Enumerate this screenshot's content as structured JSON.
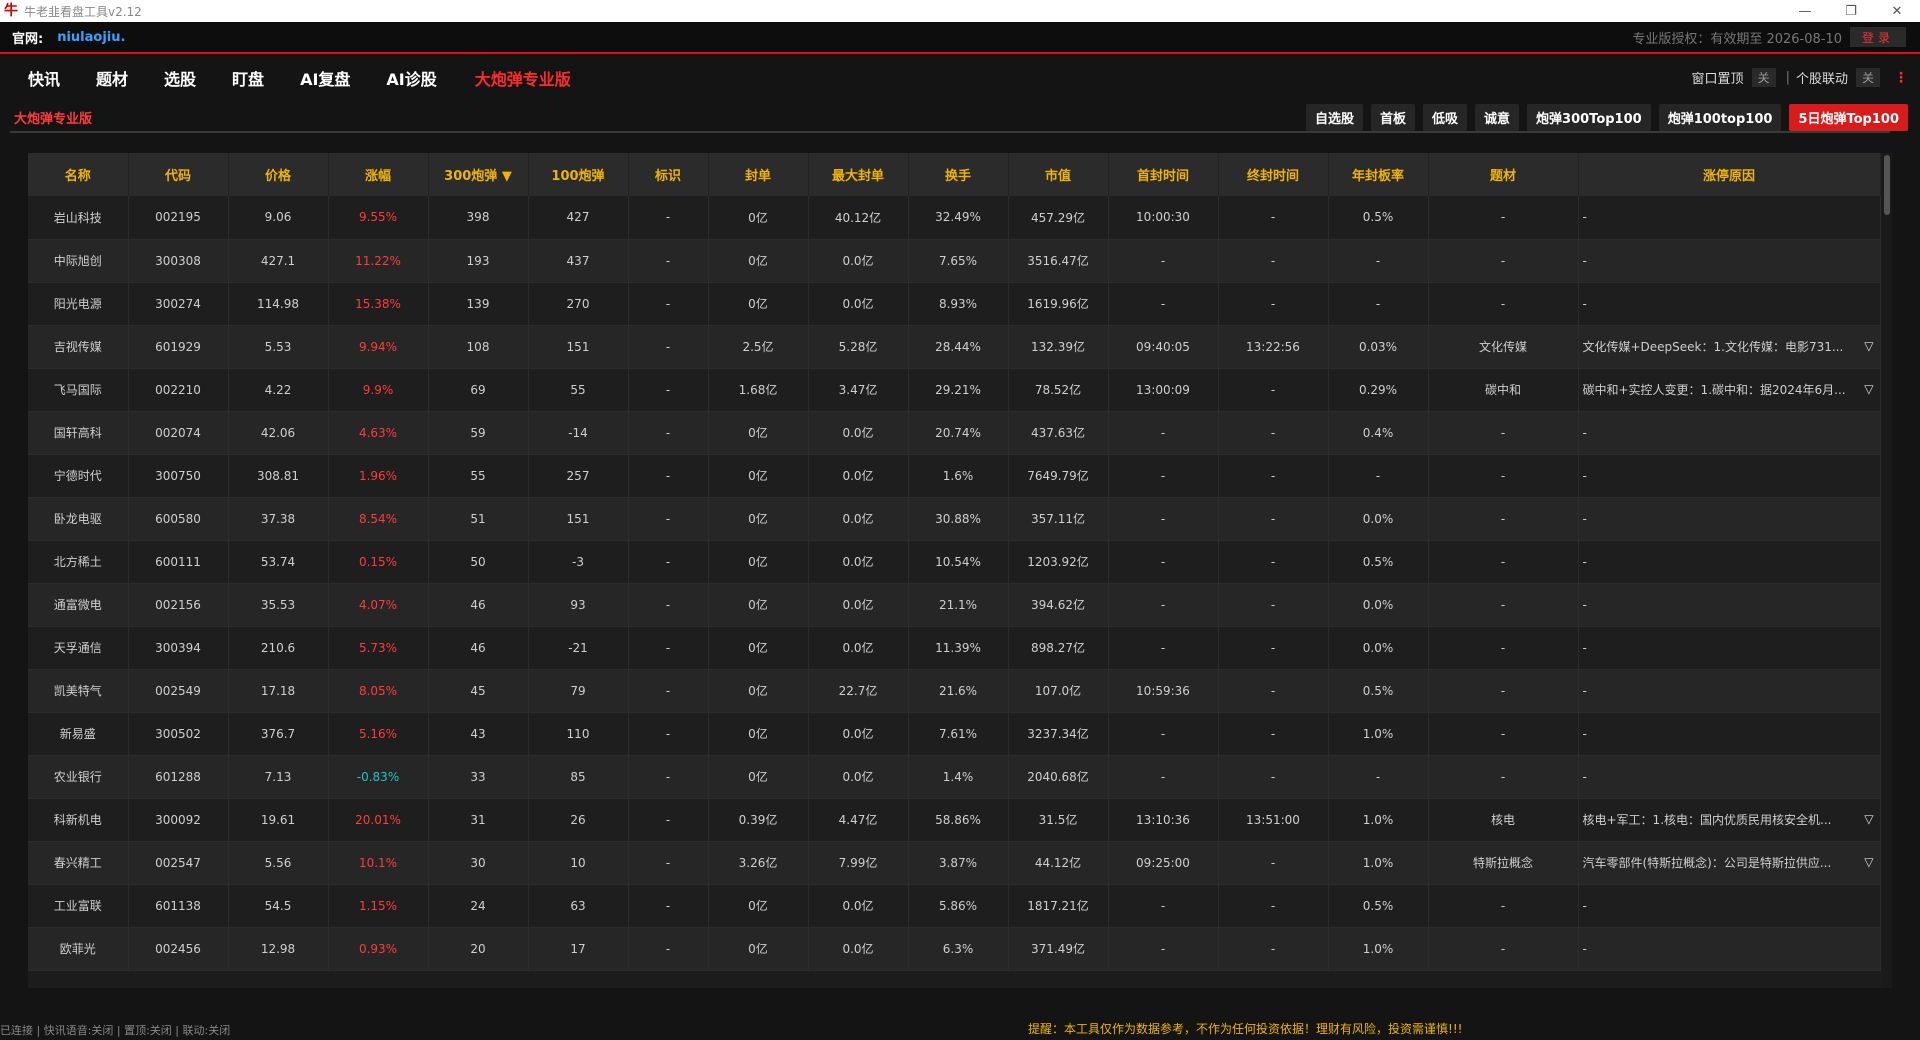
{
  "window": {
    "title": "牛老韭看盘工具v2.12",
    "logo_char": "牛",
    "minimize": "—",
    "maximize": "❐",
    "close": "✕"
  },
  "site": {
    "label": "官网:",
    "url_text": "niulaojiu.",
    "license": "专业版授权：有效期至 2026-08-10",
    "login": "登录"
  },
  "nav": {
    "items": [
      "快讯",
      "题材",
      "选股",
      "盯盘",
      "AI复盘",
      "AI诊股",
      "大炮弹专业版"
    ],
    "window_top_label": "窗口置顶",
    "window_top_state": "关",
    "stock_link_label": "个股联动",
    "stock_link_state": "关",
    "sep": "|",
    "more": "⋮"
  },
  "page": {
    "title": "大炮弹专业版",
    "tabs": [
      "自选股",
      "首板",
      "低吸",
      "诚意",
      "炮弹300Top100",
      "炮弹100top100",
      "5日炮弹Top100"
    ],
    "active_tab": 6
  },
  "table": {
    "columns": [
      "名称",
      "代码",
      "价格",
      "涨幅",
      "300炮弹 ▼",
      "100炮弹",
      "标识",
      "封单",
      "最大封单",
      "换手",
      "市值",
      "首封时间",
      "终封时间",
      "年封板率",
      "题材",
      "涨停原因"
    ],
    "rows": [
      [
        "岩山科技",
        "002195",
        "9.06",
        "9.55%",
        "398",
        "427",
        "-",
        "0亿",
        "40.12亿",
        "32.49%",
        "457.29亿",
        "10:00:30",
        "-",
        "0.5%",
        "-",
        "-"
      ],
      [
        "中际旭创",
        "300308",
        "427.1",
        "11.22%",
        "193",
        "437",
        "-",
        "0亿",
        "0.0亿",
        "7.65%",
        "3516.47亿",
        "-",
        "-",
        "-",
        "-",
        "-"
      ],
      [
        "阳光电源",
        "300274",
        "114.98",
        "15.38%",
        "139",
        "270",
        "-",
        "0亿",
        "0.0亿",
        "8.93%",
        "1619.96亿",
        "-",
        "-",
        "-",
        "-",
        "-"
      ],
      [
        "吉视传媒",
        "601929",
        "5.53",
        "9.94%",
        "108",
        "151",
        "-",
        "2.5亿",
        "5.28亿",
        "28.44%",
        "132.39亿",
        "09:40:05",
        "13:22:56",
        "0.03%",
        "文化传媒",
        "文化传媒+DeepSeek：1.文化传媒：电影731..."
      ],
      [
        "飞马国际",
        "002210",
        "4.22",
        "9.9%",
        "69",
        "55",
        "-",
        "1.68亿",
        "3.47亿",
        "29.21%",
        "78.52亿",
        "13:00:09",
        "-",
        "0.29%",
        "碳中和",
        "碳中和+实控人变更：1.碳中和：据2024年6月..."
      ],
      [
        "国轩高科",
        "002074",
        "42.06",
        "4.63%",
        "59",
        "-14",
        "-",
        "0亿",
        "0.0亿",
        "20.74%",
        "437.63亿",
        "-",
        "-",
        "0.4%",
        "-",
        "-"
      ],
      [
        "宁德时代",
        "300750",
        "308.81",
        "1.96%",
        "55",
        "257",
        "-",
        "0亿",
        "0.0亿",
        "1.6%",
        "7649.79亿",
        "-",
        "-",
        "-",
        "-",
        "-"
      ],
      [
        "卧龙电驱",
        "600580",
        "37.38",
        "8.54%",
        "51",
        "151",
        "-",
        "0亿",
        "0.0亿",
        "30.88%",
        "357.11亿",
        "-",
        "-",
        "0.0%",
        "-",
        "-"
      ],
      [
        "北方稀土",
        "600111",
        "53.74",
        "0.15%",
        "50",
        "-3",
        "-",
        "0亿",
        "0.0亿",
        "10.54%",
        "1203.92亿",
        "-",
        "-",
        "0.5%",
        "-",
        "-"
      ],
      [
        "通富微电",
        "002156",
        "35.53",
        "4.07%",
        "46",
        "93",
        "-",
        "0亿",
        "0.0亿",
        "21.1%",
        "394.62亿",
        "-",
        "-",
        "0.0%",
        "-",
        "-"
      ],
      [
        "天孚通信",
        "300394",
        "210.6",
        "5.73%",
        "46",
        "-21",
        "-",
        "0亿",
        "0.0亿",
        "11.39%",
        "898.27亿",
        "-",
        "-",
        "0.0%",
        "-",
        "-"
      ],
      [
        "凯美特气",
        "002549",
        "17.18",
        "8.05%",
        "45",
        "79",
        "-",
        "0亿",
        "22.7亿",
        "21.6%",
        "107.0亿",
        "10:59:36",
        "-",
        "0.5%",
        "-",
        "-"
      ],
      [
        "新易盛",
        "300502",
        "376.7",
        "5.16%",
        "43",
        "110",
        "-",
        "0亿",
        "0.0亿",
        "7.61%",
        "3237.34亿",
        "-",
        "-",
        "1.0%",
        "-",
        "-"
      ],
      [
        "农业银行",
        "601288",
        "7.13",
        "-0.83%",
        "33",
        "85",
        "-",
        "0亿",
        "0.0亿",
        "1.4%",
        "2040.68亿",
        "-",
        "-",
        "-",
        "-",
        "-"
      ],
      [
        "科新机电",
        "300092",
        "19.61",
        "20.01%",
        "31",
        "26",
        "-",
        "0.39亿",
        "4.47亿",
        "58.86%",
        "31.5亿",
        "13:10:36",
        "13:51:00",
        "1.0%",
        "核电",
        "核电+军工：1.核电：国内优质民用核安全机..."
      ],
      [
        "春兴精工",
        "002547",
        "5.56",
        "10.1%",
        "30",
        "10",
        "-",
        "3.26亿",
        "7.99亿",
        "3.87%",
        "44.12亿",
        "09:25:00",
        "-",
        "1.0%",
        "特斯拉概念",
        "汽车零部件(特斯拉概念)：公司是特斯拉供应..."
      ],
      [
        "工业富联",
        "601138",
        "54.5",
        "1.15%",
        "24",
        "63",
        "-",
        "0亿",
        "0.0亿",
        "5.86%",
        "1817.21亿",
        "-",
        "-",
        "0.5%",
        "-",
        "-"
      ],
      [
        "欧菲光",
        "002456",
        "12.98",
        "0.93%",
        "20",
        "17",
        "-",
        "0亿",
        "0.0亿",
        "6.3%",
        "371.49亿",
        "-",
        "-",
        "1.0%",
        "-",
        "-"
      ]
    ],
    "expand_icon": "▽"
  },
  "colors": {
    "up": "#ff3b3b",
    "down": "#22c4c4",
    "header_text": "#f0b400",
    "accent": "#d81b1b"
  },
  "status": {
    "left": "已连接 | 快讯语音:关闭 | 置顶:关闭 | 联动:关闭",
    "warning": "提醒：本工具仅作为数据参考，不作为任何投资依据！理财有风险，投资需谨慎!!!"
  }
}
